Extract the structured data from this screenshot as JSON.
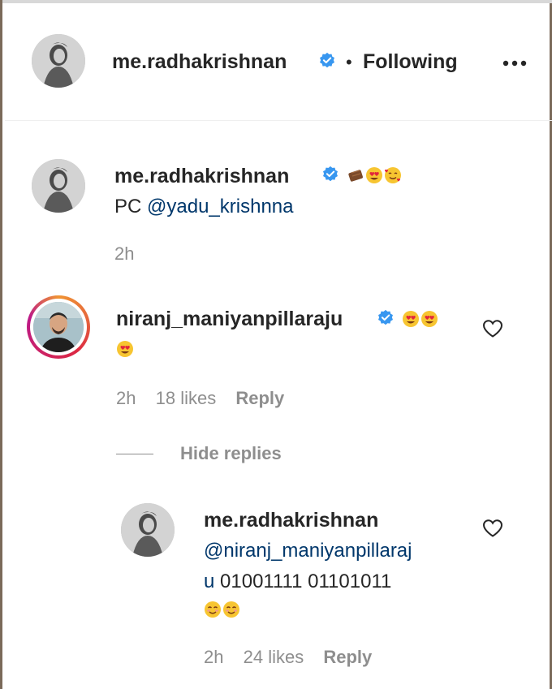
{
  "post_header": {
    "username": "me.radhakrishnan",
    "separator": "•",
    "follow_status": "Following",
    "more_label": "More options"
  },
  "caption": {
    "username": "me.radhakrishnan",
    "text_prefix": "PC",
    "mention": "@yadu_krishnna",
    "time": "2h",
    "emojis": [
      "chocolate-emoji",
      "heart-eyes-emoji",
      "smiling-hearts-emoji"
    ]
  },
  "comments": [
    {
      "username": "niranj_maniyanpillaraju",
      "emojis_line1": [
        "heart-eyes-emoji",
        "heart-eyes-emoji"
      ],
      "emojis_line2": [
        "heart-eyes-emoji"
      ],
      "time": "2h",
      "likes": "18 likes",
      "reply": "Reply",
      "hide_replies": "Hide replies",
      "replies": [
        {
          "username": "me.radhakrishnan",
          "mention_line1": "@niranj_maniyanpillaraj",
          "mention_line2_prefix": "u",
          "text": "01001111 01101011",
          "emojis": [
            "smiling-emoji",
            "smiling-emoji"
          ],
          "time": "2h",
          "likes": "24 likes",
          "reply": "Reply"
        }
      ]
    }
  ],
  "colors": {
    "text": "#262626",
    "secondary": "#8e8e8e",
    "mention": "#00376b",
    "verified": "#3897f0"
  }
}
